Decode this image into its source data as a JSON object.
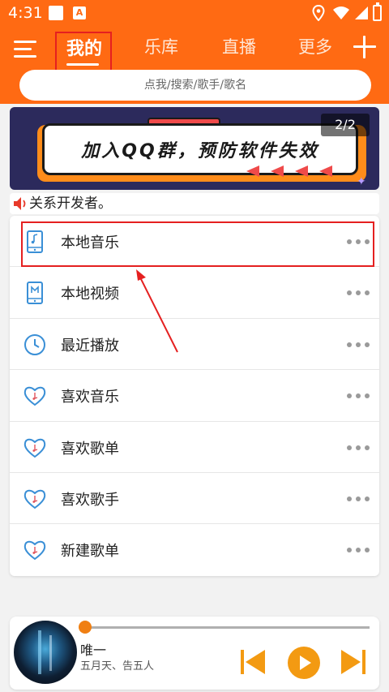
{
  "status_bar": {
    "time": "4:31",
    "notif_letter": "A"
  },
  "header": {
    "tabs": [
      {
        "label": "我的",
        "active": true
      },
      {
        "label": "乐库",
        "active": false
      },
      {
        "label": "直播",
        "active": false
      },
      {
        "label": "更多",
        "active": false
      }
    ],
    "search_placeholder": "点我/搜索/歌手/歌名"
  },
  "banner": {
    "text": "加入QQ群，预防软件失效",
    "indicator": "2/2"
  },
  "notice": {
    "text": "关系开发者。"
  },
  "list": {
    "items": [
      {
        "label": "本地音乐",
        "icon": "local-music-icon"
      },
      {
        "label": "本地视频",
        "icon": "local-video-icon"
      },
      {
        "label": "最近播放",
        "icon": "clock-icon"
      },
      {
        "label": "喜欢音乐",
        "icon": "heart-note-icon"
      },
      {
        "label": "喜欢歌单",
        "icon": "heart-note-icon"
      },
      {
        "label": "喜欢歌手",
        "icon": "heart-note-icon"
      },
      {
        "label": "新建歌单",
        "icon": "heart-note-icon"
      }
    ]
  },
  "player": {
    "title": "唯一",
    "artist": "五月天、告五人",
    "progress": 0.0
  },
  "colors": {
    "brand": "#ff6a13",
    "accent": "#f07f12",
    "icon_blue": "#3a8fd6",
    "highlight_red": "#e52020"
  }
}
